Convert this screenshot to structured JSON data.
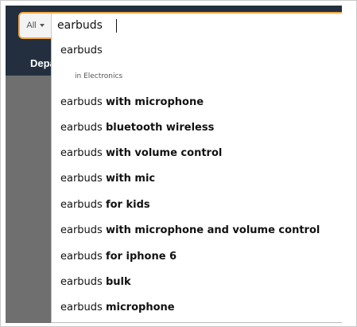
{
  "search": {
    "category_label": "All",
    "query": "earbuds"
  },
  "nav": {
    "departments_label": "Depa"
  },
  "suggestions": [
    {
      "prefix": "earbuds",
      "bold": ""
    },
    {
      "dept": "in Electronics"
    },
    {
      "prefix": "earbuds ",
      "bold": "with microphone"
    },
    {
      "prefix": "earbuds ",
      "bold": "bluetooth wireless"
    },
    {
      "prefix": "earbuds ",
      "bold": "with volume control"
    },
    {
      "prefix": "earbuds ",
      "bold": "with mic"
    },
    {
      "prefix": "earbuds ",
      "bold": "for kids"
    },
    {
      "prefix": "earbuds ",
      "bold": "with microphone and volume control"
    },
    {
      "prefix": "earbuds ",
      "bold": "for iphone 6"
    },
    {
      "prefix": "earbuds ",
      "bold": "bulk"
    },
    {
      "prefix": "earbuds ",
      "bold": "microphone"
    }
  ]
}
